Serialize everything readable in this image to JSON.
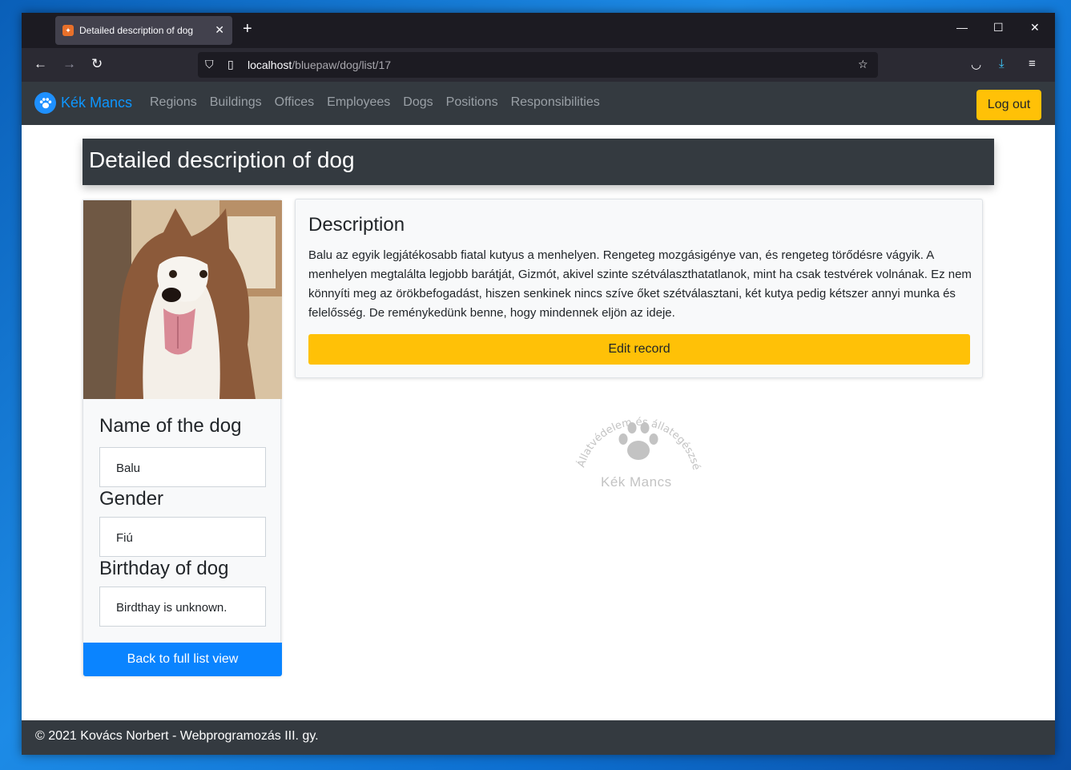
{
  "browser": {
    "tab_title": "Detailed description of dog",
    "url_host": "localhost",
    "url_path": "/bluepaw/dog/list/17"
  },
  "navbar": {
    "brand": "Kék Mancs",
    "links": [
      "Regions",
      "Buildings",
      "Offices",
      "Employees",
      "Dogs",
      "Positions",
      "Responsibilities"
    ],
    "logout": "Log out"
  },
  "page": {
    "title": "Detailed description of dog"
  },
  "dog": {
    "name_label": "Name of the dog",
    "name_value": "Balu",
    "gender_label": "Gender",
    "gender_value": "Fiú",
    "birthday_label": "Birthday of dog",
    "birthday_value": "Birdthay is unknown.",
    "back_button": "Back to full list view"
  },
  "description": {
    "title": "Description",
    "text": "Balu az egyik legjátékosabb fiatal kutyus a menhelyen. Rengeteg mozgásigénye van, és rengeteg törődésre vágyik. A menhelyen megtalálta legjobb barátját, Gizmót, akivel szinte szétválaszthatatlanok, mint ha csak testvérek volnának. Ez nem könnyíti meg az örökbefogadást, hiszen senkinek nincs szíve őket szétválasztani, két kutya pedig kétszer annyi munka és felelősség. De reménykedünk benne, hogy mindennek eljön az ideje.",
    "edit_button": "Edit record"
  },
  "stamp": {
    "arc_text": "Állatvédelem és állategészségügy",
    "name": "Kék Mancs"
  },
  "footer": {
    "text": "© 2021 Kovács Norbert - Webprogramozás III. gy."
  },
  "colors": {
    "navbar": "#343a40",
    "brand": "#0d96ff",
    "warning": "#ffc107",
    "primary": "#0a84ff"
  }
}
